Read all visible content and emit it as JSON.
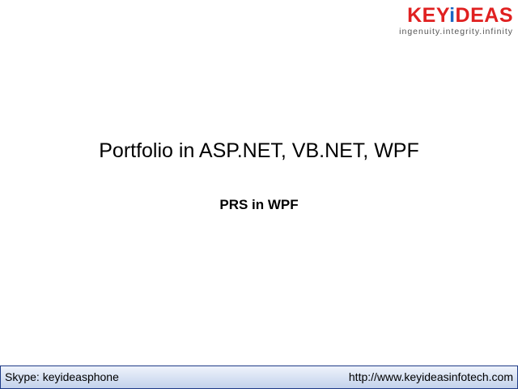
{
  "logo": {
    "brand_left": "KEY",
    "brand_i": "i",
    "brand_right": "DEAS",
    "tagline": "ingenuity.integrity.infinity",
    "colors": {
      "primary": "#e02020",
      "accent": "#1a66c4"
    }
  },
  "slide": {
    "title": "Portfolio in ASP.NET, VB.NET, WPF",
    "subtitle": "PRS in WPF"
  },
  "footer": {
    "skype": "Skype: keyideasphone",
    "website": "http://www.keyideasinfotech.com",
    "colors": {
      "background": "#c3d2ec",
      "border": "#1f3c88"
    }
  }
}
